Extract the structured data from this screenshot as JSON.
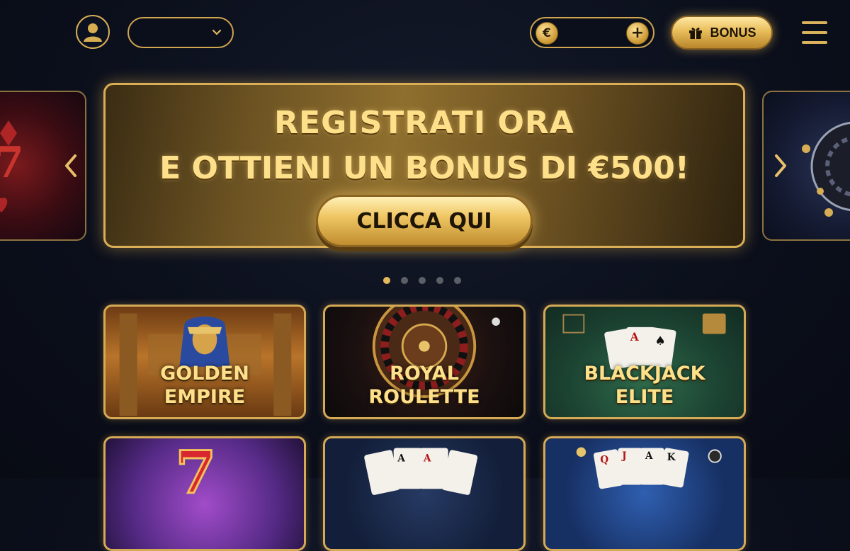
{
  "header": {
    "dropdown_value": "",
    "wallet": {
      "currency_symbol": "€",
      "balance": "",
      "add_symbol": "+"
    },
    "bonus_button": {
      "label": "BONUS"
    }
  },
  "hero": {
    "title_line1": "REGISTRATI ORA",
    "title_line2": "E OTTIENI UN BONUS DI €500!",
    "cta_label": "CLICCA QUI",
    "slide_count": 5,
    "active_slide": 1
  },
  "games": [
    {
      "line1": "GOLDEN",
      "line2": "EMPIRE"
    },
    {
      "line1": "ROYAL",
      "line2": "ROULETTE"
    },
    {
      "line1": "BLACKJACK",
      "line2": "ELITE"
    },
    {
      "line1": "",
      "line2": ""
    },
    {
      "line1": "",
      "line2": ""
    },
    {
      "line1": "",
      "line2": ""
    }
  ],
  "colors": {
    "gold": "#d9ae56",
    "gold_light": "#ffe08a",
    "background": "#0b0f1b",
    "dot_inactive": "#5d5f68"
  }
}
